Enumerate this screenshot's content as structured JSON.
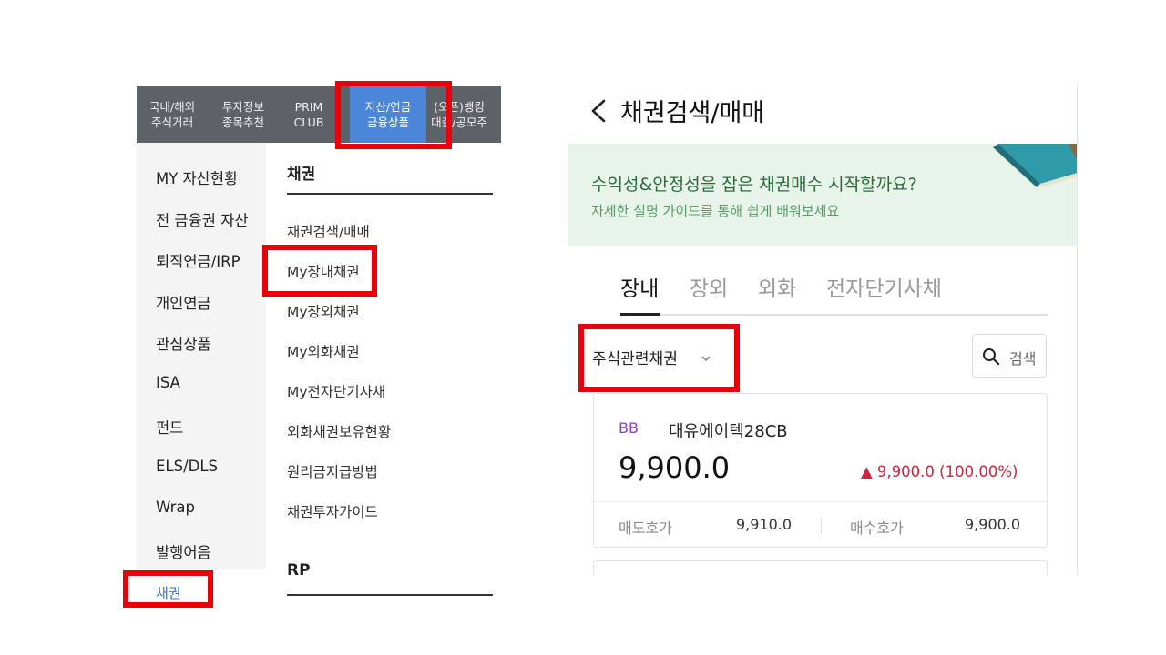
{
  "left_menu": {
    "top_nav": [
      {
        "line1": "국내/해외",
        "line2": "주식거래"
      },
      {
        "line1": "투자정보",
        "line2": "종목추천"
      },
      {
        "line1": "PRIM",
        "line2": "CLUB"
      },
      {
        "line1": "자산/연금",
        "line2": "금융상품"
      },
      {
        "line1": "(오픈)뱅킹",
        "line2": "대출/공모주"
      }
    ],
    "sidebar": [
      "MY 자산현황",
      "전 금융권 자산",
      "퇴직연금/IRP",
      "개인연금",
      "관심상품",
      "ISA",
      "펀드",
      "ELS/DLS",
      "Wrap",
      "발행어음",
      "채권"
    ],
    "submenu": {
      "section1_title": "채권",
      "items": [
        "채권검색/매매",
        "My장내채권",
        "My장외채권",
        "My외화채권",
        "My전자단기사채",
        "외화채권보유현황",
        "원리금지급방법",
        "채권투자가이드"
      ],
      "section2_title": "RP"
    }
  },
  "app": {
    "title": "채권검색/매매",
    "banner": {
      "title": "수익성&안정성을 잡은 채권매수 시작할까요?",
      "subtitle": "자세한 설명 가이드를 통해 쉽게 배워보세요"
    },
    "tabs": [
      "장내",
      "장외",
      "외화",
      "전자단기사채"
    ],
    "category": "주식관련채권",
    "search_label": "검색",
    "bond": {
      "badge": "BB",
      "name": "대유에이텍28CB",
      "price": "9,900.0",
      "change": "▲ 9,900.0 (100.00%)",
      "ask_label": "매도호가",
      "ask_value": "9,910.0",
      "bid_label": "매수호가",
      "bid_value": "9,900.0"
    }
  },
  "colors": {
    "highlight": "#e8000b",
    "active_nav": "#4b86d8",
    "banner_bg": "#e8f4ea",
    "up": "#c9263f",
    "badge": "#8a3fc8"
  }
}
